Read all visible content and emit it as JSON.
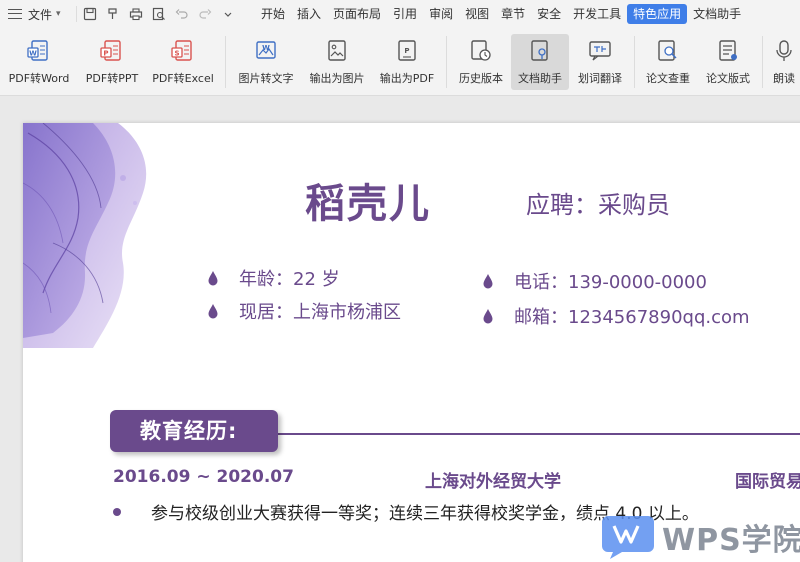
{
  "menubar": {
    "file_label": "文件",
    "tabs": [
      {
        "label": "开始"
      },
      {
        "label": "插入"
      },
      {
        "label": "页面布局"
      },
      {
        "label": "引用"
      },
      {
        "label": "审阅"
      },
      {
        "label": "视图"
      },
      {
        "label": "章节"
      },
      {
        "label": "安全"
      },
      {
        "label": "开发工具"
      },
      {
        "label": "特色应用",
        "active": true
      },
      {
        "label": "文档助手"
      }
    ]
  },
  "ribbon": {
    "buttons": [
      {
        "label": "PDF转Word",
        "icon": "pdf-to-word-icon"
      },
      {
        "label": "PDF转PPT",
        "icon": "pdf-to-ppt-icon"
      },
      {
        "label": "PDF转Excel",
        "icon": "pdf-to-excel-icon"
      },
      {
        "label": "图片转文字",
        "icon": "image-to-text-icon"
      },
      {
        "label": "输出为图片",
        "icon": "export-image-icon"
      },
      {
        "label": "输出为PDF",
        "icon": "export-pdf-icon"
      },
      {
        "label": "历史版本",
        "icon": "history-icon"
      },
      {
        "label": "文档助手",
        "icon": "doc-assistant-icon",
        "selected": true
      },
      {
        "label": "划词翻译",
        "icon": "translate-icon"
      },
      {
        "label": "论文查重",
        "icon": "plagiarism-check-icon"
      },
      {
        "label": "论文版式",
        "icon": "paper-format-icon"
      },
      {
        "label": "朗读",
        "icon": "read-aloud-icon"
      }
    ]
  },
  "resume": {
    "name": "稻壳儿",
    "position": "应聘：采购员",
    "age": "年龄：22 岁",
    "residence": "现居：上海市杨浦区",
    "phone": "电话：139-0000-0000",
    "email": "邮箱：1234567890qq.com",
    "education_title": "教育经历:",
    "education": {
      "period": "2016.09 ~ 2020.07",
      "school": "上海对外经贸大学",
      "major": "国际贸易",
      "achievement": "参与校级创业大赛获得一等奖；连续三年获得校奖学金，绩点 4.0 以上。"
    }
  },
  "watermark": {
    "text": "WPS学院"
  },
  "colors": {
    "accent": "#6a4a8c",
    "active_tab": "#3f7ee8"
  }
}
